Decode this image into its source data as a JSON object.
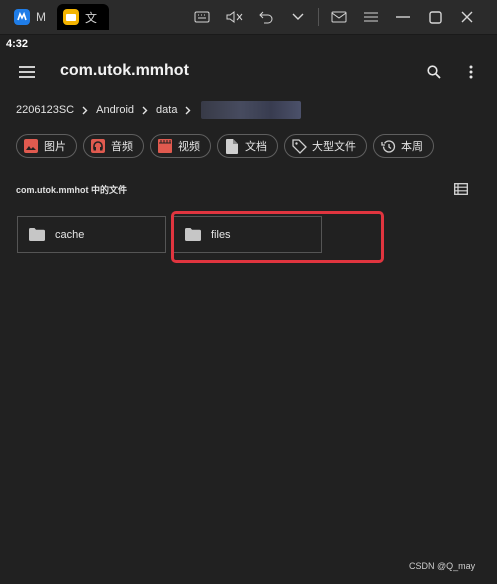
{
  "window": {
    "tabs": [
      {
        "label": "M",
        "icon": "app-logo-icon",
        "color": "#1f7de8"
      },
      {
        "label": "文",
        "icon": "folder-app-icon",
        "color": "#f4b400"
      }
    ]
  },
  "status_bar": {
    "time": "4:32"
  },
  "app_bar": {
    "title": "com.utok.mmhot"
  },
  "breadcrumb": [
    "2206123SC",
    "Android",
    "data"
  ],
  "chips": [
    {
      "label": "图片",
      "icon": "image-icon",
      "color": "#e05a4f"
    },
    {
      "label": "音频",
      "icon": "headphones-icon",
      "color": "#e05a4f"
    },
    {
      "label": "视频",
      "icon": "video-icon",
      "color": "#e05a4f"
    },
    {
      "label": "文档",
      "icon": "document-icon",
      "color": "#cfcfcf"
    },
    {
      "label": "大型文件",
      "icon": "tag-icon",
      "color": "#cfcfcf"
    },
    {
      "label": "本周",
      "icon": "history-icon",
      "color": "#cfcfcf"
    }
  ],
  "section": {
    "title": "com.utok.mmhot 中的文件"
  },
  "folders": [
    {
      "name": "cache"
    },
    {
      "name": "files"
    }
  ],
  "watermark": "CSDN @Q_may",
  "colors": {
    "highlight": "#e0353f",
    "background": "#212121"
  }
}
